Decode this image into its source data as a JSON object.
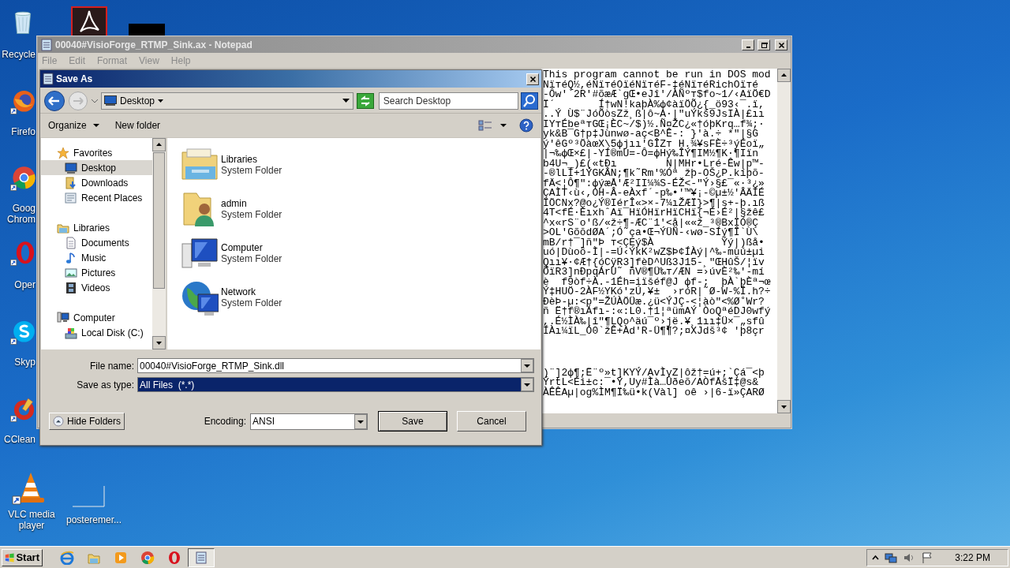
{
  "desktop": {
    "icons": [
      {
        "kind": "recycle",
        "label": [
          "Recycle"
        ]
      },
      {
        "kind": "swirl"
      },
      {
        "kind": "thumbnail"
      },
      {
        "kind": "firefox",
        "label": [
          "Firefo"
        ]
      },
      {
        "kind": "chrome",
        "label": [
          "Goog",
          "Chrom"
        ]
      },
      {
        "kind": "opera",
        "label": [
          "Oper"
        ]
      },
      {
        "kind": "skype",
        "label": [
          "Skyp"
        ]
      },
      {
        "kind": "ccleaner",
        "label": [
          "CClean"
        ]
      },
      {
        "kind": "vlc",
        "label": [
          "VLC media",
          "player"
        ]
      },
      {
        "kind": "blank",
        "label": [
          "posteremer..."
        ]
      }
    ]
  },
  "notepad": {
    "title": "00040#VisioForge_RTMP_Sink.ax - Notepad",
    "menu": [
      "File",
      "Edit",
      "Format",
      "View",
      "Help"
    ],
    "text_blocks": [
      [
        "This program cannot be run in DOS mod",
        "NïтéQ½,éNïтéOïéNïтéF-‡éNïтéRichOïтé",
        "-Ôw'`2R'#õæÆ`gŒ•eJî'/ÀÑºт$fo~1/‹AïÖ€D",
        "Ï´       Í†wN!kaþÀ%ф¢àïÖÕ¿{_ö93‹¯.ï,",
        "..Ý Ù$¨JóÕòsZž¸ß|ô~A·|\"uÝkš9JsIÀ|£ıı",
        "IYтÉbeªтGŒ¡ÈC~/$)½.Ñ¤ŽC¿«†óþKrq…f¾;·",
        "yk&B¯G†p‡Jùnwø-aç<B^Ê-: }'à.÷ *\"|§G",
        "ý'êGº³ÖàœX\\5фjıı'GÎZт H.¾¥sFÈ÷³ýÉoï„",
        "|¬‰фŒ×£|-YÍ®mU=-Ô=фHý‰ÎÝ¶IM½¶K·¶Iïn",
        "b4U¬_)£(«tÐı        N|MHr•Lré-Êw|p™-",
        "-®lLÍ+1ÝGKÂN;¶k˜Rm'%Óª žþ-OŠ¿P.kíþõ-",
        "fÄ<¦Ô¶\":фýæÅ'Æ²II¼¾S-ÉŽ<-\"Ý›§£¯«·³¿»",
        "ÇAÌT‹ù‹,OH-Â-eÀxf´-p‰•'™¥¡-©µ±½'ÂÄÍÉ",
        "ÏÖCNx?@o¿Ý®IérÎ«>×-7¼ıŽÆÏ}>¶|s+-þ.ıß",
        "4T<fÉ·ÈıxhˆAï¯HïÓHïrHïCHï{¬É›É²|§žê£",
        "^x«rS¨o'ß/«ž÷¶-ÆC¨1'<å|««ž_³®BxÏÓ®Ç",
        ">OL'GõōdØA´;Ó˜ça•Œ¬ÝÜÑ-‹wø-SÍý¶Î`Ù\\",
        "mB/r†¯]ñ\"Þ т<ÇEý$À           Ýý|)ßå•",
        "uó|Dùoö-Ì|-=Ú‹ÝkK²wZ$Þ¢ÍÀý|^‰-mùú±µi",
        "Qıı¥·¢Æ†{óCÿR3]fèD^Uß3J15-¸\"ŒHûŠ/¦ïv",
        "ÕïR3]nÐpqÁrÙ˜ ñV®¶Ü‰т/ÆN =›úvÈ²‰'-mí",
        "è  f9òf÷À.-1Éh=iïšéf@J фf-;  þÀ`þÈª¬œ",
        "Ý‡HUÖ-2ÀF½YKó'zÚ,¥±  ›róR|˜Ø-W-%Î.h?÷",
        "ÐèÞ-µ:<p\"=ŽÚÀÖÜæ.¿ü<ÝJÇ-<¦àò\"<%Ø˚Wr?",
        "ñ Ë†f®ıÁfı-:«:L0.†1¦ªümAÝ ÒoQªéDJ0wfý",
        ",.É½ÌÀ‰|î\"¶LQo^äú¯º›jë.¥¸1ıı‡Ü×¯„sfû",
        "ÍÀı¼ïL_Ó0`žÊ+Àd'R-Ü¶¶?;¤XJdš³¢ 'þ8çr"
      ],
      [
        ")¨]2ф¶;Ë¨º»t]KYÝ/AvÌyZ|ôž†=ú+;`Çá¯<þ",
        "ÝrtL<Éi±c:¯•Ý,Uy#Ìà…Ûðeõ/AÒfÅšÏ‡@s&",
        "ÀÊÊAµ|og%ÌM¶Ï‰ü•k(Vàl] oê ›|6-ï»ÇARØ"
      ]
    ]
  },
  "save_dialog": {
    "title": "Save As",
    "location": "Desktop",
    "search": {
      "placeholder": "Search Desktop"
    },
    "toolbar": [
      {
        "kind": "menu",
        "label": "Organize"
      },
      {
        "kind": "plain",
        "label": "New folder"
      }
    ],
    "sidebar": [
      {
        "label": "Favorites",
        "kind": "star",
        "selected": false,
        "children": [
          {
            "label": "Desktop",
            "kind": "desktop",
            "selected": true
          },
          {
            "label": "Downloads",
            "kind": "downloads",
            "selected": false
          },
          {
            "label": "Recent Places",
            "kind": "recent",
            "selected": false
          }
        ]
      },
      {
        "label": "Libraries",
        "kind": "library",
        "selected": false,
        "children": [
          {
            "label": "Documents",
            "kind": "document",
            "selected": false
          },
          {
            "label": "Music",
            "kind": "music",
            "selected": false
          },
          {
            "label": "Pictures",
            "kind": "picture",
            "selected": false
          },
          {
            "label": "Videos",
            "kind": "video",
            "selected": false
          }
        ]
      },
      {
        "label": "Computer",
        "kind": "computer",
        "selected": false,
        "children": [
          {
            "label": "Local Disk (C:)",
            "kind": "disk",
            "selected": false
          }
        ]
      }
    ],
    "items": [
      {
        "name": "Libraries",
        "type": "System Folder",
        "kind": "library"
      },
      {
        "name": "admin",
        "type": "System Folder",
        "kind": "user"
      },
      {
        "name": "Computer",
        "type": "System Folder",
        "kind": "computer"
      },
      {
        "name": "Network",
        "type": "System Folder",
        "kind": "network"
      }
    ],
    "file_name": {
      "label": "File name:",
      "value": "00040#VisioForge_RTMP_Sink.dll",
      "selected": false
    },
    "save_as_type": {
      "label": "Save as type:",
      "value": "All Files  (*.*)",
      "selected": true
    },
    "hide_folders": "Hide Folders",
    "encoding": {
      "label": "Encoding:",
      "value": "ANSI"
    },
    "buttons": [
      {
        "label": "Save",
        "default": true
      },
      {
        "label": "Cancel",
        "default": false
      }
    ]
  },
  "taskbar": {
    "start": "Start",
    "apps": [
      {
        "kind": "ie",
        "active": false
      },
      {
        "kind": "explorer",
        "active": false
      },
      {
        "kind": "media",
        "active": false
      },
      {
        "kind": "chrome",
        "active": false
      },
      {
        "kind": "opera",
        "active": false
      },
      {
        "kind": "notepad",
        "active": true
      }
    ],
    "clock": "3:22 PM"
  }
}
